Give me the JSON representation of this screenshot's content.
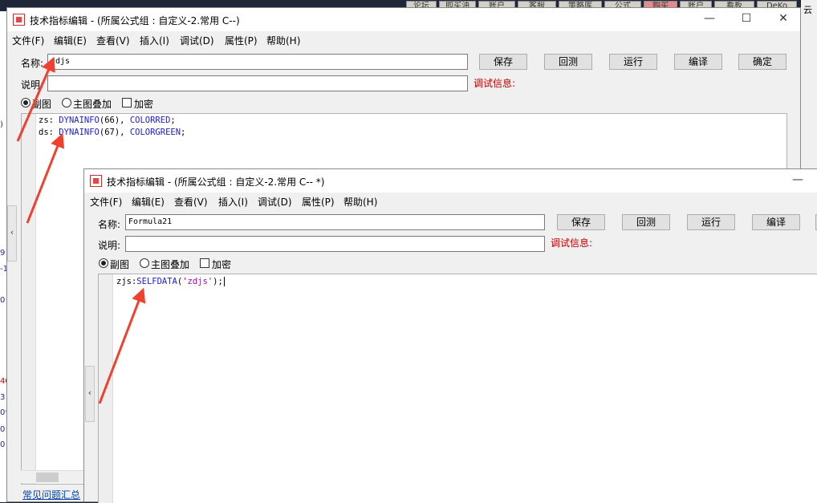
{
  "background": {
    "tabs": [
      "论坛",
      "即买油",
      "账户",
      "客服",
      "策略库",
      "公式",
      "购买",
      "账户",
      "看板",
      "DeKo"
    ],
    "right_text": "云",
    "left_marks": [
      ")",
      "9",
      "-1",
      "0",
      "40",
      "3",
      "0*",
      "0",
      "0"
    ]
  },
  "window1": {
    "title": "技术指标编辑 - (所属公式组 : 自定义-2.常用 C--)",
    "menu": [
      "文件(F)",
      "编辑(E)",
      "查看(V)",
      "插入(I)",
      "调试(D)",
      "属性(P)",
      "帮助(H)"
    ],
    "name_label": "名称:",
    "name_value": "zdjs",
    "desc_label": "说明:",
    "desc_value": "",
    "debug_label": "调试信息:",
    "buttons": {
      "save": "保存",
      "backtest": "回测",
      "run": "运行",
      "compile": "编译",
      "ok": "确定"
    },
    "radio_sub": "副图",
    "radio_main": "主图叠加",
    "encrypt": "加密",
    "code": {
      "line1": {
        "var": "zs:",
        "fn": "DYNAINFO",
        "arg": "(66),",
        "color": "COLORRED",
        "end": ";"
      },
      "line2": {
        "var": "ds:",
        "fn": "DYNAINFO",
        "arg": "(67),",
        "color": "COLORGREEN",
        "end": ";"
      }
    },
    "faq_link": "常见问题汇总"
  },
  "window2": {
    "title": "技术指标编辑 - (所属公式组 : 自定义-2.常用 C-- *)",
    "menu": [
      "文件(F)",
      "编辑(E)",
      "查看(V)",
      "插入(I)",
      "调试(D)",
      "属性(P)",
      "帮助(H)"
    ],
    "name_label": "名称:",
    "name_value": "Formula21",
    "desc_label": "说明:",
    "desc_value": "",
    "debug_label": "调试信息:",
    "buttons": {
      "save": "保存",
      "backtest": "回测",
      "run": "运行",
      "compile": "编译"
    },
    "radio_sub": "副图",
    "radio_main": "主图叠加",
    "encrypt": "加密",
    "code": {
      "var": "zjs:",
      "fn": "SELFDATA",
      "open": "(",
      "arg": "'zdjs'",
      "close": ");"
    }
  },
  "colors": {
    "arrow": "#f04030",
    "debug": "#c00000",
    "keyword": "#1c1cd0",
    "string": "#b000b0"
  },
  "icons": {
    "close": "close-icon",
    "maximize": "maximize-icon",
    "minimize": "minimize-icon",
    "collapse": "chevron-left-icon"
  }
}
